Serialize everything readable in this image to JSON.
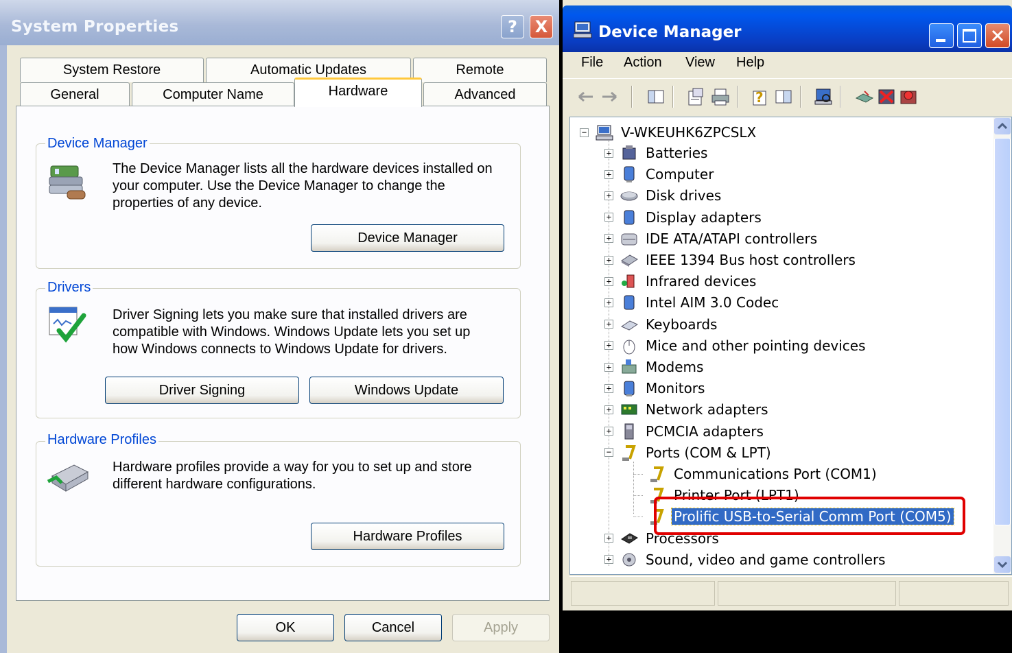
{
  "system_properties": {
    "title": "System Properties",
    "help_button": "?",
    "close_button": "X",
    "tabs_row1": [
      "System Restore",
      "Automatic Updates",
      "Remote"
    ],
    "tabs_row2": [
      "General",
      "Computer Name",
      "Hardware",
      "Advanced"
    ],
    "active_tab": "Hardware",
    "device_manager_group": {
      "title": "Device Manager",
      "text": "The Device Manager lists all the hardware devices installed on your computer. Use the Device Manager to change the properties of any device.",
      "button": "Device Manager"
    },
    "drivers_group": {
      "title": "Drivers",
      "text": "Driver Signing lets you make sure that installed drivers are compatible with Windows. Windows Update lets you set up how Windows connects to Windows Update for drivers.",
      "button_signing": "Driver Signing",
      "button_update": "Windows Update"
    },
    "hardware_profiles_group": {
      "title": "Hardware Profiles",
      "text": "Hardware profiles provide a way for you to set up and store different hardware configurations.",
      "button": "Hardware Profiles"
    },
    "ok_button": "OK",
    "cancel_button": "Cancel",
    "apply_button": "Apply"
  },
  "device_manager": {
    "title": "Device Manager",
    "menu": [
      "File",
      "Action",
      "View",
      "Help"
    ],
    "root": "V-WKEUHK6ZPCSLX",
    "categories": [
      {
        "label": "Batteries",
        "icon": "battery-icon"
      },
      {
        "label": "Computer",
        "icon": "computer-icon"
      },
      {
        "label": "Disk drives",
        "icon": "disk-drive-icon"
      },
      {
        "label": "Display adapters",
        "icon": "display-adapter-icon"
      },
      {
        "label": "IDE ATA/ATAPI controllers",
        "icon": "ide-controller-icon"
      },
      {
        "label": "IEEE 1394 Bus host controllers",
        "icon": "ieee1394-icon"
      },
      {
        "label": "Infrared devices",
        "icon": "infrared-icon"
      },
      {
        "label": "Intel AIM 3.0 Codec",
        "icon": "codec-icon"
      },
      {
        "label": "Keyboards",
        "icon": "keyboard-icon"
      },
      {
        "label": "Mice and other pointing devices",
        "icon": "mouse-icon"
      },
      {
        "label": "Modems",
        "icon": "modem-icon"
      },
      {
        "label": "Monitors",
        "icon": "monitor-icon"
      },
      {
        "label": "Network adapters",
        "icon": "network-adapter-icon"
      },
      {
        "label": "PCMCIA adapters",
        "icon": "pcmcia-icon"
      },
      {
        "label": "Ports (COM & LPT)",
        "icon": "port-icon"
      }
    ],
    "ports_children": [
      "Communications Port (COM1)",
      "Printer Port (LPT1)",
      "Prolific USB-to-Serial Comm Port (COM5)"
    ],
    "after_ports": [
      {
        "label": "Processors",
        "icon": "processor-icon"
      },
      {
        "label": "Sound, video and game controllers",
        "icon": "sound-icon"
      }
    ],
    "selected_item": "Prolific USB-to-Serial Comm Port (COM5)",
    "expander_plus": "+",
    "expander_minus": "−"
  },
  "colors": {
    "xp_blue_title": "#0058ee",
    "group_title": "#0046d5",
    "selection": "#316ac5",
    "highlight_box": "#e00000"
  }
}
